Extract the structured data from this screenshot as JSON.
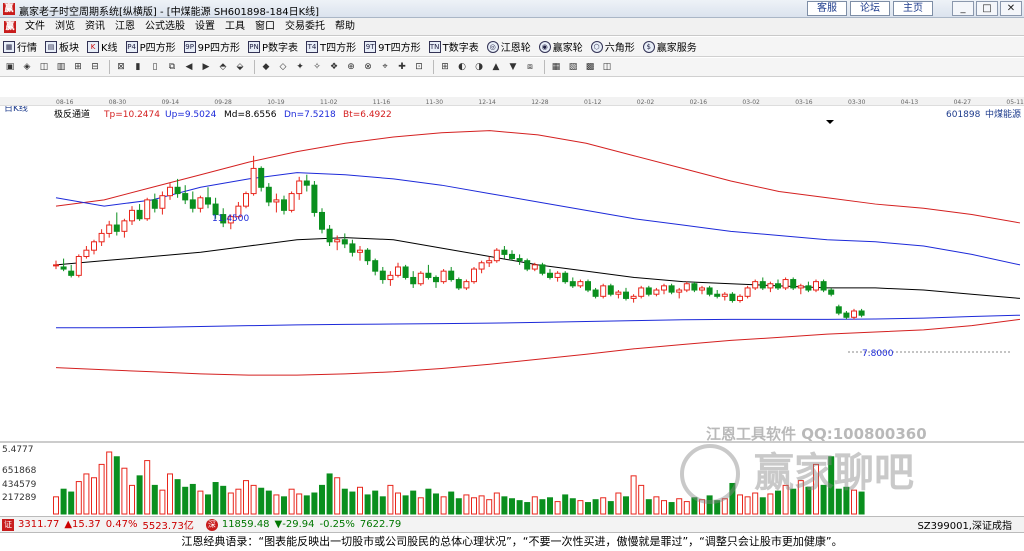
{
  "window": {
    "title": "赢家老子时空周期系统[纵横版] - [中煤能源  SH601898-184日K线]",
    "header_links": [
      "客服",
      "论坛",
      "主页"
    ],
    "window_buttons": [
      "_",
      "□",
      "✕"
    ]
  },
  "menu": [
    "文件",
    "浏览",
    "资讯",
    "江恩",
    "公式选股",
    "设置",
    "工具",
    "窗口",
    "交易委托",
    "帮助"
  ],
  "toolbar": [
    "行情",
    "板块",
    "K线",
    "P四方形",
    "9P四方形",
    "P数字表",
    "T四方形",
    "9T四方形",
    "T数字表",
    "江恩轮",
    "赢家轮",
    "六角形",
    "赢家服务"
  ],
  "chart_header": {
    "period_label": "日K线",
    "indicator": "极反通道",
    "tp": "Tp=10.2474",
    "up": "Up=9.5024",
    "md": "Md=8.6556",
    "dn": "Dn=7.5218",
    "bt": "Bt=6.4922",
    "stock_code": "601898",
    "stock_name": "中煤能源"
  },
  "date_scale": [
    "08-16",
    "08-30",
    "09-14",
    "09-28",
    "10-19",
    "11-02",
    "11-16",
    "11-30",
    "12-14",
    "12-28",
    "01-12",
    "02-02",
    "02-16",
    "03-02",
    "03-16",
    "03-30",
    "04-13",
    "04-27",
    "05-11"
  ],
  "annotations": {
    "high": "11.4500",
    "low": "7.8000",
    "vol_axis_top": "5.4777"
  },
  "volume_axis": [
    "651868",
    "434579",
    "217289"
  ],
  "watermark": {
    "line1": "江恩工具软件  QQ:100800360",
    "line2": "赢家聊吧"
  },
  "status": {
    "sh_index": "3311.77",
    "sh_change": "▲15.37",
    "sh_pct": "0.47%",
    "sh_amount": "5523.73亿",
    "sz_index": "11859.48",
    "sz_change": "▼-29.94",
    "sz_pct": "-0.25%",
    "sz_amount": "7622.79",
    "right": "SZ399001,深证成指"
  },
  "quote": "江恩经典语录：“图表能反映出一切股市或公司股民的总体心理状况”，“不要一次性买进，傲慢就是罪过”，“调整只会让股市更加健康”。",
  "colors": {
    "up": "#e8261c",
    "down": "#0a8f1e",
    "band_outer": "#d42020",
    "band_inner": "#1d2ad9",
    "mid": "#000000"
  },
  "chart_data": {
    "type": "candlestick",
    "ylim": [
      6.2,
      12.4
    ],
    "candles": [
      [
        8.85,
        8.95,
        8.75,
        8.85
      ],
      [
        8.8,
        9.0,
        8.7,
        8.75
      ],
      [
        8.7,
        8.85,
        8.55,
        8.6
      ],
      [
        8.6,
        9.1,
        8.55,
        9.05
      ],
      [
        9.05,
        9.3,
        9.0,
        9.2
      ],
      [
        9.2,
        9.45,
        9.1,
        9.4
      ],
      [
        9.4,
        9.7,
        9.3,
        9.6
      ],
      [
        9.6,
        9.9,
        9.5,
        9.8
      ],
      [
        9.8,
        10.1,
        9.55,
        9.65
      ],
      [
        9.65,
        9.95,
        9.5,
        9.9
      ],
      [
        9.9,
        10.25,
        9.8,
        10.15
      ],
      [
        10.15,
        10.3,
        9.9,
        9.95
      ],
      [
        9.95,
        10.45,
        9.9,
        10.4
      ],
      [
        10.4,
        10.55,
        10.1,
        10.2
      ],
      [
        10.2,
        10.6,
        10.05,
        10.5
      ],
      [
        10.5,
        10.8,
        10.4,
        10.7
      ],
      [
        10.7,
        10.9,
        10.45,
        10.55
      ],
      [
        10.55,
        10.75,
        10.3,
        10.4
      ],
      [
        10.4,
        10.6,
        10.1,
        10.2
      ],
      [
        10.2,
        10.5,
        10.1,
        10.45
      ],
      [
        10.45,
        10.7,
        10.2,
        10.3
      ],
      [
        10.3,
        10.45,
        9.95,
        10.05
      ],
      [
        10.05,
        10.2,
        9.75,
        9.85
      ],
      [
        9.85,
        10.05,
        9.7,
        10.0
      ],
      [
        10.0,
        10.35,
        9.95,
        10.25
      ],
      [
        10.25,
        10.6,
        10.2,
        10.55
      ],
      [
        10.55,
        11.45,
        10.5,
        11.15
      ],
      [
        11.15,
        11.2,
        10.6,
        10.7
      ],
      [
        10.7,
        10.8,
        10.25,
        10.35
      ],
      [
        10.35,
        10.55,
        10.1,
        10.4
      ],
      [
        10.4,
        10.5,
        10.05,
        10.15
      ],
      [
        10.15,
        10.6,
        10.1,
        10.55
      ],
      [
        10.55,
        10.95,
        10.4,
        10.85
      ],
      [
        10.85,
        11.0,
        10.6,
        10.75
      ],
      [
        10.75,
        10.85,
        10.0,
        10.1
      ],
      [
        10.1,
        10.2,
        9.6,
        9.7
      ],
      [
        9.7,
        9.8,
        9.3,
        9.4
      ],
      [
        9.4,
        9.55,
        9.2,
        9.45
      ],
      [
        9.45,
        9.6,
        9.25,
        9.35
      ],
      [
        9.35,
        9.45,
        9.05,
        9.15
      ],
      [
        9.15,
        9.3,
        8.95,
        9.2
      ],
      [
        9.2,
        9.25,
        8.85,
        8.95
      ],
      [
        8.95,
        9.0,
        8.6,
        8.7
      ],
      [
        8.7,
        8.8,
        8.4,
        8.5
      ],
      [
        8.5,
        8.7,
        8.35,
        8.6
      ],
      [
        8.6,
        8.9,
        8.55,
        8.8
      ],
      [
        8.8,
        8.85,
        8.5,
        8.55
      ],
      [
        8.55,
        8.7,
        8.3,
        8.4
      ],
      [
        8.4,
        8.7,
        8.35,
        8.65
      ],
      [
        8.65,
        8.85,
        8.5,
        8.55
      ],
      [
        8.55,
        8.6,
        8.3,
        8.45
      ],
      [
        8.45,
        8.75,
        8.4,
        8.7
      ],
      [
        8.7,
        8.8,
        8.45,
        8.5
      ],
      [
        8.5,
        8.55,
        8.25,
        8.3
      ],
      [
        8.3,
        8.5,
        8.25,
        8.45
      ],
      [
        8.45,
        8.8,
        8.4,
        8.75
      ],
      [
        8.75,
        8.95,
        8.65,
        8.9
      ],
      [
        8.9,
        9.05,
        8.8,
        8.95
      ],
      [
        8.95,
        9.25,
        8.9,
        9.2
      ],
      [
        9.2,
        9.3,
        9.0,
        9.1
      ],
      [
        9.1,
        9.2,
        8.95,
        9.0
      ],
      [
        9.0,
        9.1,
        8.85,
        8.95
      ],
      [
        8.95,
        9.0,
        8.7,
        8.75
      ],
      [
        8.75,
        8.9,
        8.7,
        8.85
      ],
      [
        8.85,
        8.9,
        8.6,
        8.65
      ],
      [
        8.65,
        8.75,
        8.5,
        8.55
      ],
      [
        8.55,
        8.7,
        8.45,
        8.65
      ],
      [
        8.65,
        8.7,
        8.4,
        8.45
      ],
      [
        8.45,
        8.55,
        8.3,
        8.35
      ],
      [
        8.35,
        8.5,
        8.3,
        8.45
      ],
      [
        8.45,
        8.5,
        8.2,
        8.25
      ],
      [
        8.25,
        8.3,
        8.05,
        8.1
      ],
      [
        8.1,
        8.4,
        8.05,
        8.35
      ],
      [
        8.35,
        8.4,
        8.1,
        8.15
      ],
      [
        8.15,
        8.25,
        8.05,
        8.2
      ],
      [
        8.2,
        8.3,
        8.0,
        8.05
      ],
      [
        8.05,
        8.15,
        7.95,
        8.1
      ],
      [
        8.1,
        8.35,
        8.05,
        8.3
      ],
      [
        8.3,
        8.35,
        8.1,
        8.15
      ],
      [
        8.15,
        8.3,
        8.1,
        8.25
      ],
      [
        8.25,
        8.4,
        8.15,
        8.35
      ],
      [
        8.35,
        8.4,
        8.15,
        8.2
      ],
      [
        8.2,
        8.3,
        8.05,
        8.25
      ],
      [
        8.25,
        8.45,
        8.2,
        8.4
      ],
      [
        8.4,
        8.45,
        8.2,
        8.25
      ],
      [
        8.25,
        8.35,
        8.15,
        8.3
      ],
      [
        8.3,
        8.35,
        8.1,
        8.15
      ],
      [
        8.15,
        8.25,
        8.05,
        8.1
      ],
      [
        8.1,
        8.2,
        8.0,
        8.15
      ],
      [
        8.15,
        8.2,
        7.95,
        8.0
      ],
      [
        8.0,
        8.15,
        7.95,
        8.1
      ],
      [
        8.1,
        8.35,
        8.05,
        8.3
      ],
      [
        8.3,
        8.5,
        8.25,
        8.45
      ],
      [
        8.45,
        8.55,
        8.25,
        8.3
      ],
      [
        8.3,
        8.45,
        8.2,
        8.4
      ],
      [
        8.4,
        8.5,
        8.25,
        8.3
      ],
      [
        8.3,
        8.55,
        8.25,
        8.5
      ],
      [
        8.5,
        8.55,
        8.25,
        8.3
      ],
      [
        8.3,
        8.4,
        8.15,
        8.35
      ],
      [
        8.35,
        8.45,
        8.2,
        8.25
      ],
      [
        8.25,
        8.5,
        8.2,
        8.45
      ],
      [
        8.45,
        8.5,
        8.2,
        8.25
      ],
      [
        8.25,
        8.3,
        8.1,
        8.15
      ],
      [
        7.85,
        7.9,
        7.65,
        7.7
      ],
      [
        7.7,
        7.75,
        7.55,
        7.6
      ],
      [
        7.6,
        7.8,
        7.55,
        7.75
      ],
      [
        7.75,
        7.8,
        7.6,
        7.65
      ]
    ],
    "bands": {
      "top": [
        10.25,
        10.4,
        10.7,
        11.0,
        11.3,
        11.55,
        11.75,
        11.9,
        12.0,
        12.05,
        11.95,
        11.75,
        11.45,
        11.15,
        10.85,
        10.6,
        10.45,
        10.3,
        10.2,
        10.05,
        9.85
      ],
      "up": [
        10.45,
        10.25,
        10.4,
        10.7,
        10.9,
        11.05,
        11.0,
        10.9,
        10.75,
        10.55,
        10.35,
        10.15,
        9.95,
        9.8,
        9.65,
        9.55,
        9.45,
        9.4,
        9.3,
        9.1,
        8.85
      ],
      "mid": [
        8.85,
        8.95,
        9.05,
        9.15,
        9.3,
        9.45,
        9.5,
        9.45,
        9.25,
        9.05,
        8.85,
        8.7,
        8.55,
        8.45,
        8.4,
        8.35,
        8.3,
        8.3,
        8.25,
        8.15,
        8.05
      ],
      "dn": [
        7.35,
        7.35,
        7.36,
        7.38,
        7.4,
        7.42,
        7.43,
        7.44,
        7.45,
        7.46,
        7.48,
        7.5,
        7.52,
        7.54,
        7.55,
        7.55,
        7.55,
        7.56,
        7.58,
        7.62,
        7.65
      ],
      "bottom": [
        6.4,
        6.35,
        6.3,
        6.25,
        6.22,
        6.22,
        6.25,
        6.3,
        6.38,
        6.48,
        6.6,
        6.72,
        6.85,
        6.95,
        7.05,
        7.12,
        7.2,
        7.25,
        7.3,
        7.4,
        7.55
      ]
    },
    "volume_max": 651868,
    "volumes": [
      180,
      260,
      230,
      340,
      420,
      380,
      520,
      650,
      600,
      480,
      300,
      400,
      560,
      300,
      250,
      420,
      360,
      280,
      310,
      240,
      200,
      330,
      290,
      220,
      260,
      350,
      300,
      270,
      240,
      200,
      180,
      260,
      210,
      190,
      220,
      300,
      420,
      380,
      260,
      230,
      280,
      200,
      240,
      180,
      300,
      220,
      190,
      240,
      170,
      260,
      210,
      180,
      230,
      160,
      200,
      170,
      190,
      150,
      220,
      180,
      160,
      140,
      120,
      180,
      150,
      170,
      130,
      200,
      160,
      140,
      120,
      150,
      170,
      130,
      220,
      180,
      400,
      300,
      150,
      180,
      140,
      120,
      160,
      130,
      170,
      150,
      190,
      140,
      160,
      320,
      200,
      180,
      220,
      170,
      210,
      240,
      300,
      260,
      350,
      280,
      520,
      300,
      600,
      260,
      280,
      250,
      230
    ]
  }
}
